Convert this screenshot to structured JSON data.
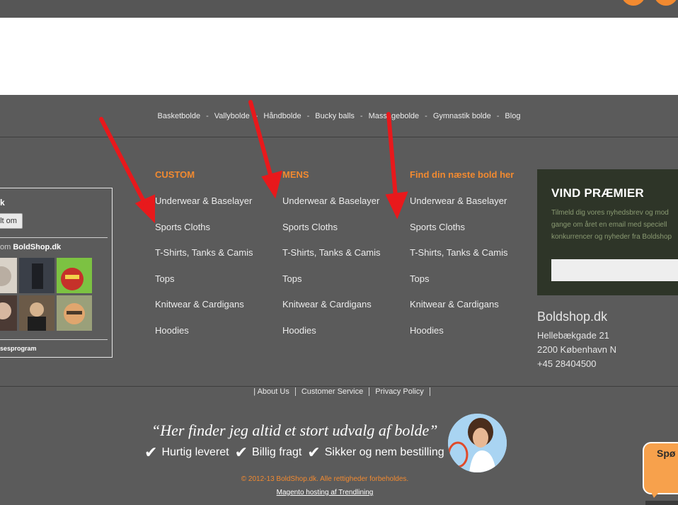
{
  "category_nav": [
    "Basketbolde",
    "Vallybolde",
    "Håndbolde",
    "Bucky balls",
    "Massagebolde",
    "Gymnastik bolde",
    "Blog"
  ],
  "category_nav_separator": "-",
  "facebook_box": {
    "title_fragment": "k",
    "like_button_fragment": "lt om",
    "friends_prefix": "om",
    "friends_page": "BoldShop.dk",
    "plugin_label": "sesprogram"
  },
  "columns": [
    {
      "heading": "CUSTOM",
      "links": [
        "Underwear & Baselayer",
        "Sports Cloths",
        "T-Shirts, Tanks & Camis",
        "Tops",
        "Knitwear & Cardigans",
        "Hoodies"
      ]
    },
    {
      "heading": "MENS",
      "links": [
        "Underwear & Baselayer",
        "Sports Cloths",
        "T-Shirts, Tanks & Camis",
        "Tops",
        "Knitwear & Cardigans",
        "Hoodies"
      ]
    },
    {
      "heading": "Find din næste bold her",
      "links": [
        "Underwear & Baselayer",
        "Sports Cloths",
        "T-Shirts, Tanks & Camis",
        "Tops",
        "Knitwear & Cardigans",
        "Hoodies"
      ]
    }
  ],
  "newsletter": {
    "title": "VIND PRÆMIER",
    "text": "Tilmeld dig vores nyhedsbrev og mod\ngange om året en email med speciell\nkonkurrencer og nyheder fra Boldshop",
    "input_value": ""
  },
  "shop": {
    "name": "Boldshop.dk",
    "address": "Hellebækgade 21",
    "city": "2200 København N",
    "phone": "+45 28404500"
  },
  "legal_links": [
    "| About Us",
    "Customer Service",
    "Privacy Policy"
  ],
  "tagline": "“Her finder jeg altid et stort udvalg af  bolde”",
  "usps": [
    "Hurtig leveret",
    "Billig fragt",
    "Sikker og nem bestilling"
  ],
  "copyright": "© 2012-13 BoldShop.dk. Alle rettigheder forbeholdes.",
  "hosting": "Magento hosting af Trendlining",
  "chat_label": "Spø",
  "colors": {
    "accent": "#f28a30",
    "footer_bg": "#5b5b5b",
    "arrow": "#e8191c",
    "newsletter_bg": "#2e3528"
  },
  "icons": [
    "checkmark-icon",
    "red-arrow-annotation",
    "chat-bubble-icon"
  ]
}
